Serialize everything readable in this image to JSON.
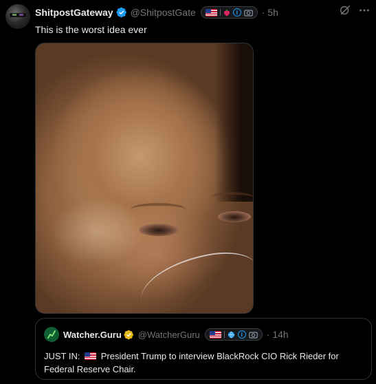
{
  "tweet": {
    "author_name": "ShitpostGateway",
    "author_handle": "@ShitpostGate",
    "time": "· 5h",
    "text": "This is the worst idea ever",
    "badges": [
      "us-flag-icon",
      "strawberry-icon",
      "info-icon",
      "camera-icon"
    ],
    "media_description": "close-up photo of a crying man with a nasal oxygen tube"
  },
  "quote": {
    "author_name": "Watcher.Guru",
    "author_handle": "@WatcherGuru",
    "time": "· 14h",
    "badges": [
      "us-flag-icon",
      "globe-icon",
      "info-icon",
      "camera-icon"
    ],
    "text_prefix": "JUST IN:",
    "text_body": "President Trump to interview BlackRock CIO Rick Rieder for Federal Reserve Chair."
  },
  "colors": {
    "background": "#000000",
    "text_primary": "#e7e9ea",
    "text_secondary": "#71767b",
    "verified_blue": "#1d9bf0",
    "verified_gold": "#e2b719",
    "border": "#2f3336"
  }
}
